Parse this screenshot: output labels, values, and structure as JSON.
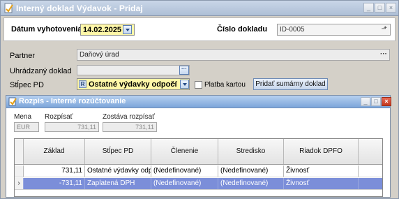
{
  "window": {
    "title": "Interný doklad Výdavok - Pridaj",
    "min_glyph": "_",
    "max_glyph": "□",
    "close_glyph": "×"
  },
  "header": {
    "date_label": "Dátum vyhotovenia",
    "date_value": "14.02.2025",
    "doc_label": "Číslo dokladu",
    "doc_value": "ID-0005",
    "doc_edit_glyph": "⬏"
  },
  "form": {
    "partner_label": "Partner",
    "partner_value": "Daňový úrad",
    "ellipsis": "···",
    "uhradzany_label": "Uhrádzaný doklad",
    "uhradzany_value": "",
    "stlpec_label": "Stĺpec PD",
    "stlpec_badge": "R",
    "stlpec_value": "Ostatné výdavky odpočíta",
    "stlpec_ellipsis": "···",
    "platba_label": "Platba kartou",
    "platba_checked": false,
    "pridat_label": "Pridať sumárny doklad"
  },
  "rozpis": {
    "title": "Rozpis - Interné rozúčtovanie",
    "mena_label": "Mena",
    "mena_value": "EUR",
    "rozpisat_label": "Rozpísať",
    "rozpisat_value": "731,11",
    "zostava_label": "Zostáva rozpísať",
    "zostava_value": "731,11",
    "grid": {
      "columns": [
        "Základ",
        "Stĺpec PD",
        "Členenie",
        "Stredisko",
        "Riadok DPFO"
      ],
      "rows": [
        {
          "indicator": "",
          "zaklad": "731,11",
          "stlpec": "Ostatné výdavky odp",
          "clenenie": "(Nedefinované)",
          "stredisko": "(Nedefinované)",
          "riadok": "Živnosť",
          "selected": false
        },
        {
          "indicator": "›",
          "zaklad": "-731,11",
          "stlpec": "Zaplatená DPH",
          "clenenie": "(Nedefinované)",
          "stredisko": "(Nedefinované)",
          "riadok": "Živnosť",
          "selected": true
        }
      ]
    }
  },
  "colors": {
    "titlebar": "#aebfd6",
    "inner_titlebar": "#7ca5da",
    "mandatory_field": "#fff7a8",
    "selected_row": "#7b8ed9"
  }
}
